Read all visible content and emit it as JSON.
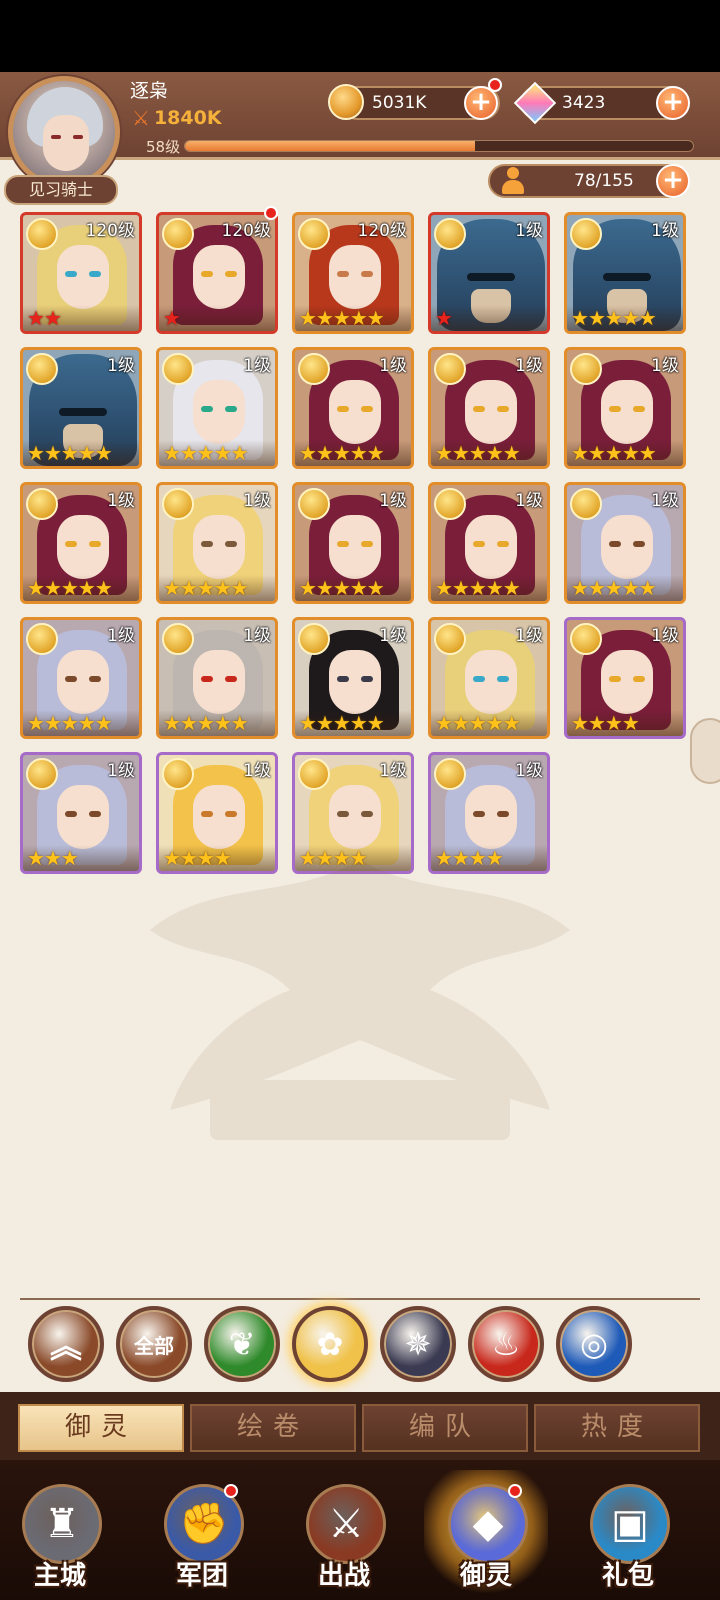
{
  "player": {
    "name": "逐枭",
    "power": "1840K",
    "level": "58级",
    "exp_fraction": 0.57,
    "title": "见习骑士"
  },
  "resources": {
    "coins": "5031K",
    "gems": "3423",
    "roster": "78/155"
  },
  "heroes": [
    {
      "level": "120级",
      "stars": 2,
      "star_color": "red",
      "frame": "red",
      "type": "blonde-knight",
      "dot": false
    },
    {
      "level": "120级",
      "stars": 1,
      "star_color": "red",
      "frame": "red",
      "type": "red-hair",
      "dot": true
    },
    {
      "level": "120级",
      "stars": 5,
      "star_color": "gold",
      "frame": "orange",
      "type": "red-hair-closed",
      "dot": false
    },
    {
      "level": "1级",
      "stars": 1,
      "star_color": "red",
      "frame": "red",
      "type": "helm",
      "dot": false
    },
    {
      "level": "1级",
      "stars": 5,
      "star_color": "gold",
      "frame": "orange",
      "type": "helm",
      "dot": false
    },
    {
      "level": "1级",
      "stars": 5,
      "star_color": "gold",
      "frame": "orange",
      "type": "helm",
      "dot": false
    },
    {
      "level": "1级",
      "stars": 5,
      "star_color": "gold",
      "frame": "orange",
      "type": "white-hair",
      "dot": false
    },
    {
      "level": "1级",
      "stars": 5,
      "star_color": "gold",
      "frame": "orange",
      "type": "red-hair",
      "dot": false
    },
    {
      "level": "1级",
      "stars": 5,
      "star_color": "gold",
      "frame": "orange",
      "type": "red-hair",
      "dot": false
    },
    {
      "level": "1级",
      "stars": 5,
      "star_color": "gold",
      "frame": "orange",
      "type": "red-hair",
      "dot": false
    },
    {
      "level": "1级",
      "stars": 5,
      "star_color": "gold",
      "frame": "orange",
      "type": "red-hair",
      "dot": false
    },
    {
      "level": "1级",
      "stars": 5,
      "star_color": "gold",
      "frame": "orange",
      "type": "blonde-spiky",
      "dot": false
    },
    {
      "level": "1级",
      "stars": 5,
      "star_color": "gold",
      "frame": "orange",
      "type": "red-hair",
      "dot": false
    },
    {
      "level": "1级",
      "stars": 5,
      "star_color": "gold",
      "frame": "orange",
      "type": "red-hair",
      "dot": false
    },
    {
      "level": "1级",
      "stars": 5,
      "star_color": "gold",
      "frame": "orange",
      "type": "silver-man",
      "dot": false
    },
    {
      "level": "1级",
      "stars": 5,
      "star_color": "gold",
      "frame": "orange",
      "type": "silver-man",
      "dot": false
    },
    {
      "level": "1级",
      "stars": 5,
      "star_color": "gold",
      "frame": "orange",
      "type": "grey-hair",
      "dot": false
    },
    {
      "level": "1级",
      "stars": 5,
      "star_color": "gold",
      "frame": "orange",
      "type": "black-hair",
      "dot": false
    },
    {
      "level": "1级",
      "stars": 5,
      "star_color": "gold",
      "frame": "orange",
      "type": "blonde-knight",
      "dot": false
    },
    {
      "level": "1级",
      "stars": 4,
      "star_color": "gold",
      "frame": "purple",
      "type": "red-hair",
      "dot": false
    },
    {
      "level": "1级",
      "stars": 3,
      "star_color": "gold",
      "frame": "purple",
      "type": "silver-man",
      "dot": false
    },
    {
      "level": "1级",
      "stars": 4,
      "star_color": "gold",
      "frame": "purple",
      "type": "blonde-girl",
      "dot": false
    },
    {
      "level": "1级",
      "stars": 4,
      "star_color": "gold",
      "frame": "purple",
      "type": "blonde-spiky",
      "dot": false
    },
    {
      "level": "1级",
      "stars": 4,
      "star_color": "gold",
      "frame": "purple",
      "type": "silver-man",
      "dot": false
    }
  ],
  "filters": [
    {
      "name": "collapse",
      "text": "",
      "icon": "double-chevron-up-icon",
      "color": "#8a4a2a"
    },
    {
      "name": "all",
      "text": "全部",
      "icon": "",
      "color": "#8a4a2a"
    },
    {
      "name": "nature",
      "text": "",
      "icon": "leaf-swirl-icon",
      "color": "#2e8a2a"
    },
    {
      "name": "light",
      "text": "",
      "icon": "rose-icon",
      "color": "#f0c24a"
    },
    {
      "name": "dark",
      "text": "",
      "icon": "star-sigil-icon",
      "color": "#3a3a52"
    },
    {
      "name": "fire",
      "text": "",
      "icon": "phoenix-icon",
      "color": "#c8281c"
    },
    {
      "name": "water",
      "text": "",
      "icon": "wave-icon",
      "color": "#1e5ab8"
    }
  ],
  "subtabs": [
    "御灵",
    "绘卷",
    "编队",
    "热度"
  ],
  "nav": [
    {
      "label": "主城",
      "icon": "castle-statue-icon",
      "dot": false
    },
    {
      "label": "军团",
      "icon": "fist-shield-icon",
      "dot": true
    },
    {
      "label": "出战",
      "icon": "gate-sword-icon",
      "dot": false
    },
    {
      "label": "御灵",
      "icon": "crystal-icon",
      "dot": true,
      "active": true
    },
    {
      "label": "礼包",
      "icon": "gift-shop-icon",
      "dot": false
    }
  ]
}
